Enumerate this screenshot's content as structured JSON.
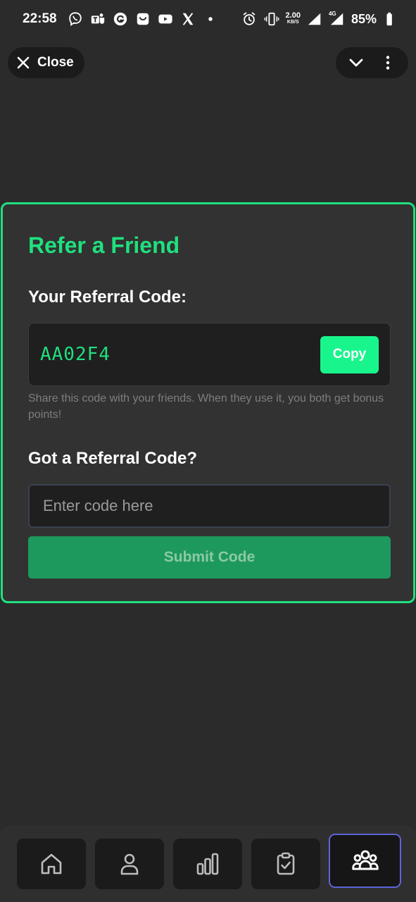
{
  "status_bar": {
    "time": "22:58",
    "net_speed_value": "2.00",
    "net_speed_unit": "KB/S",
    "network_label": "4G",
    "battery": "85%",
    "notification_icons": [
      "viber-icon",
      "teams-icon",
      "grammarly-icon",
      "bag-icon",
      "youtube-icon",
      "x-icon"
    ]
  },
  "header": {
    "close_label": "Close"
  },
  "referral": {
    "title": "Refer a Friend",
    "your_code_label": "Your Referral Code:",
    "code": "AA02F4",
    "copy_label": "Copy",
    "helper_text": "Share this code with your friends. When they use it, you both get bonus points!",
    "got_code_label": "Got a Referral Code?",
    "input_placeholder": "Enter code here",
    "input_value": "",
    "submit_label": "Submit Code"
  },
  "bottom_nav": {
    "items": [
      {
        "icon": "home-icon",
        "active": false
      },
      {
        "icon": "user-icon",
        "active": false
      },
      {
        "icon": "stats-icon",
        "active": false
      },
      {
        "icon": "tasks-icon",
        "active": false
      },
      {
        "icon": "friends-icon",
        "active": true
      }
    ]
  },
  "colors": {
    "accent": "#1fe07f",
    "copy_button": "#19f58d",
    "submit_button": "#1e995d",
    "background": "#2b2b2b",
    "card": "#323232",
    "active_nav_border": "#5d64d8"
  }
}
